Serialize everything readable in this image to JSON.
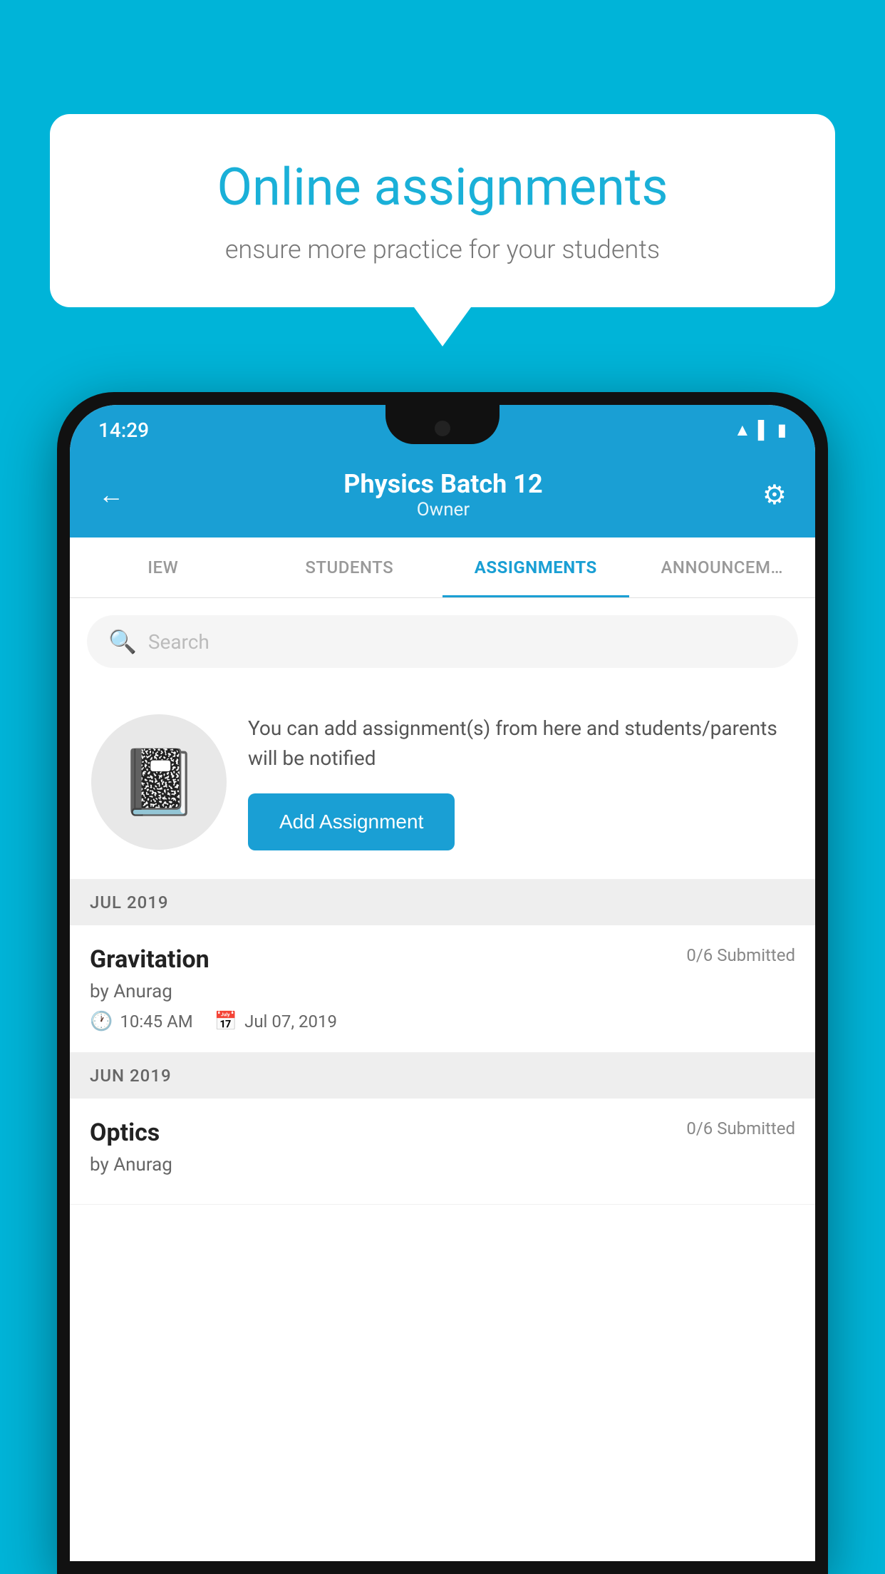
{
  "background_color": "#00b4d8",
  "speech_bubble": {
    "title": "Online assignments",
    "subtitle": "ensure more practice for your students"
  },
  "status_bar": {
    "time": "14:29",
    "icons": [
      "wifi",
      "signal",
      "battery"
    ]
  },
  "header": {
    "title": "Physics Batch 12",
    "subtitle": "Owner",
    "back_label": "←",
    "gear_label": "⚙"
  },
  "tabs": [
    {
      "label": "IEW",
      "active": false
    },
    {
      "label": "STUDENTS",
      "active": false
    },
    {
      "label": "ASSIGNMENTS",
      "active": true
    },
    {
      "label": "ANNOUNCEM…",
      "active": false
    }
  ],
  "search": {
    "placeholder": "Search"
  },
  "promo": {
    "icon": "📓",
    "description": "You can add assignment(s) from here and students/parents will be notified",
    "button_label": "Add Assignment"
  },
  "sections": [
    {
      "month_label": "JUL 2019",
      "assignments": [
        {
          "title": "Gravitation",
          "submitted": "0/6 Submitted",
          "author": "by Anurag",
          "time": "10:45 AM",
          "date": "Jul 07, 2019"
        }
      ]
    },
    {
      "month_label": "JUN 2019",
      "assignments": [
        {
          "title": "Optics",
          "submitted": "0/6 Submitted",
          "author": "by Anurag",
          "time": "",
          "date": ""
        }
      ]
    }
  ]
}
